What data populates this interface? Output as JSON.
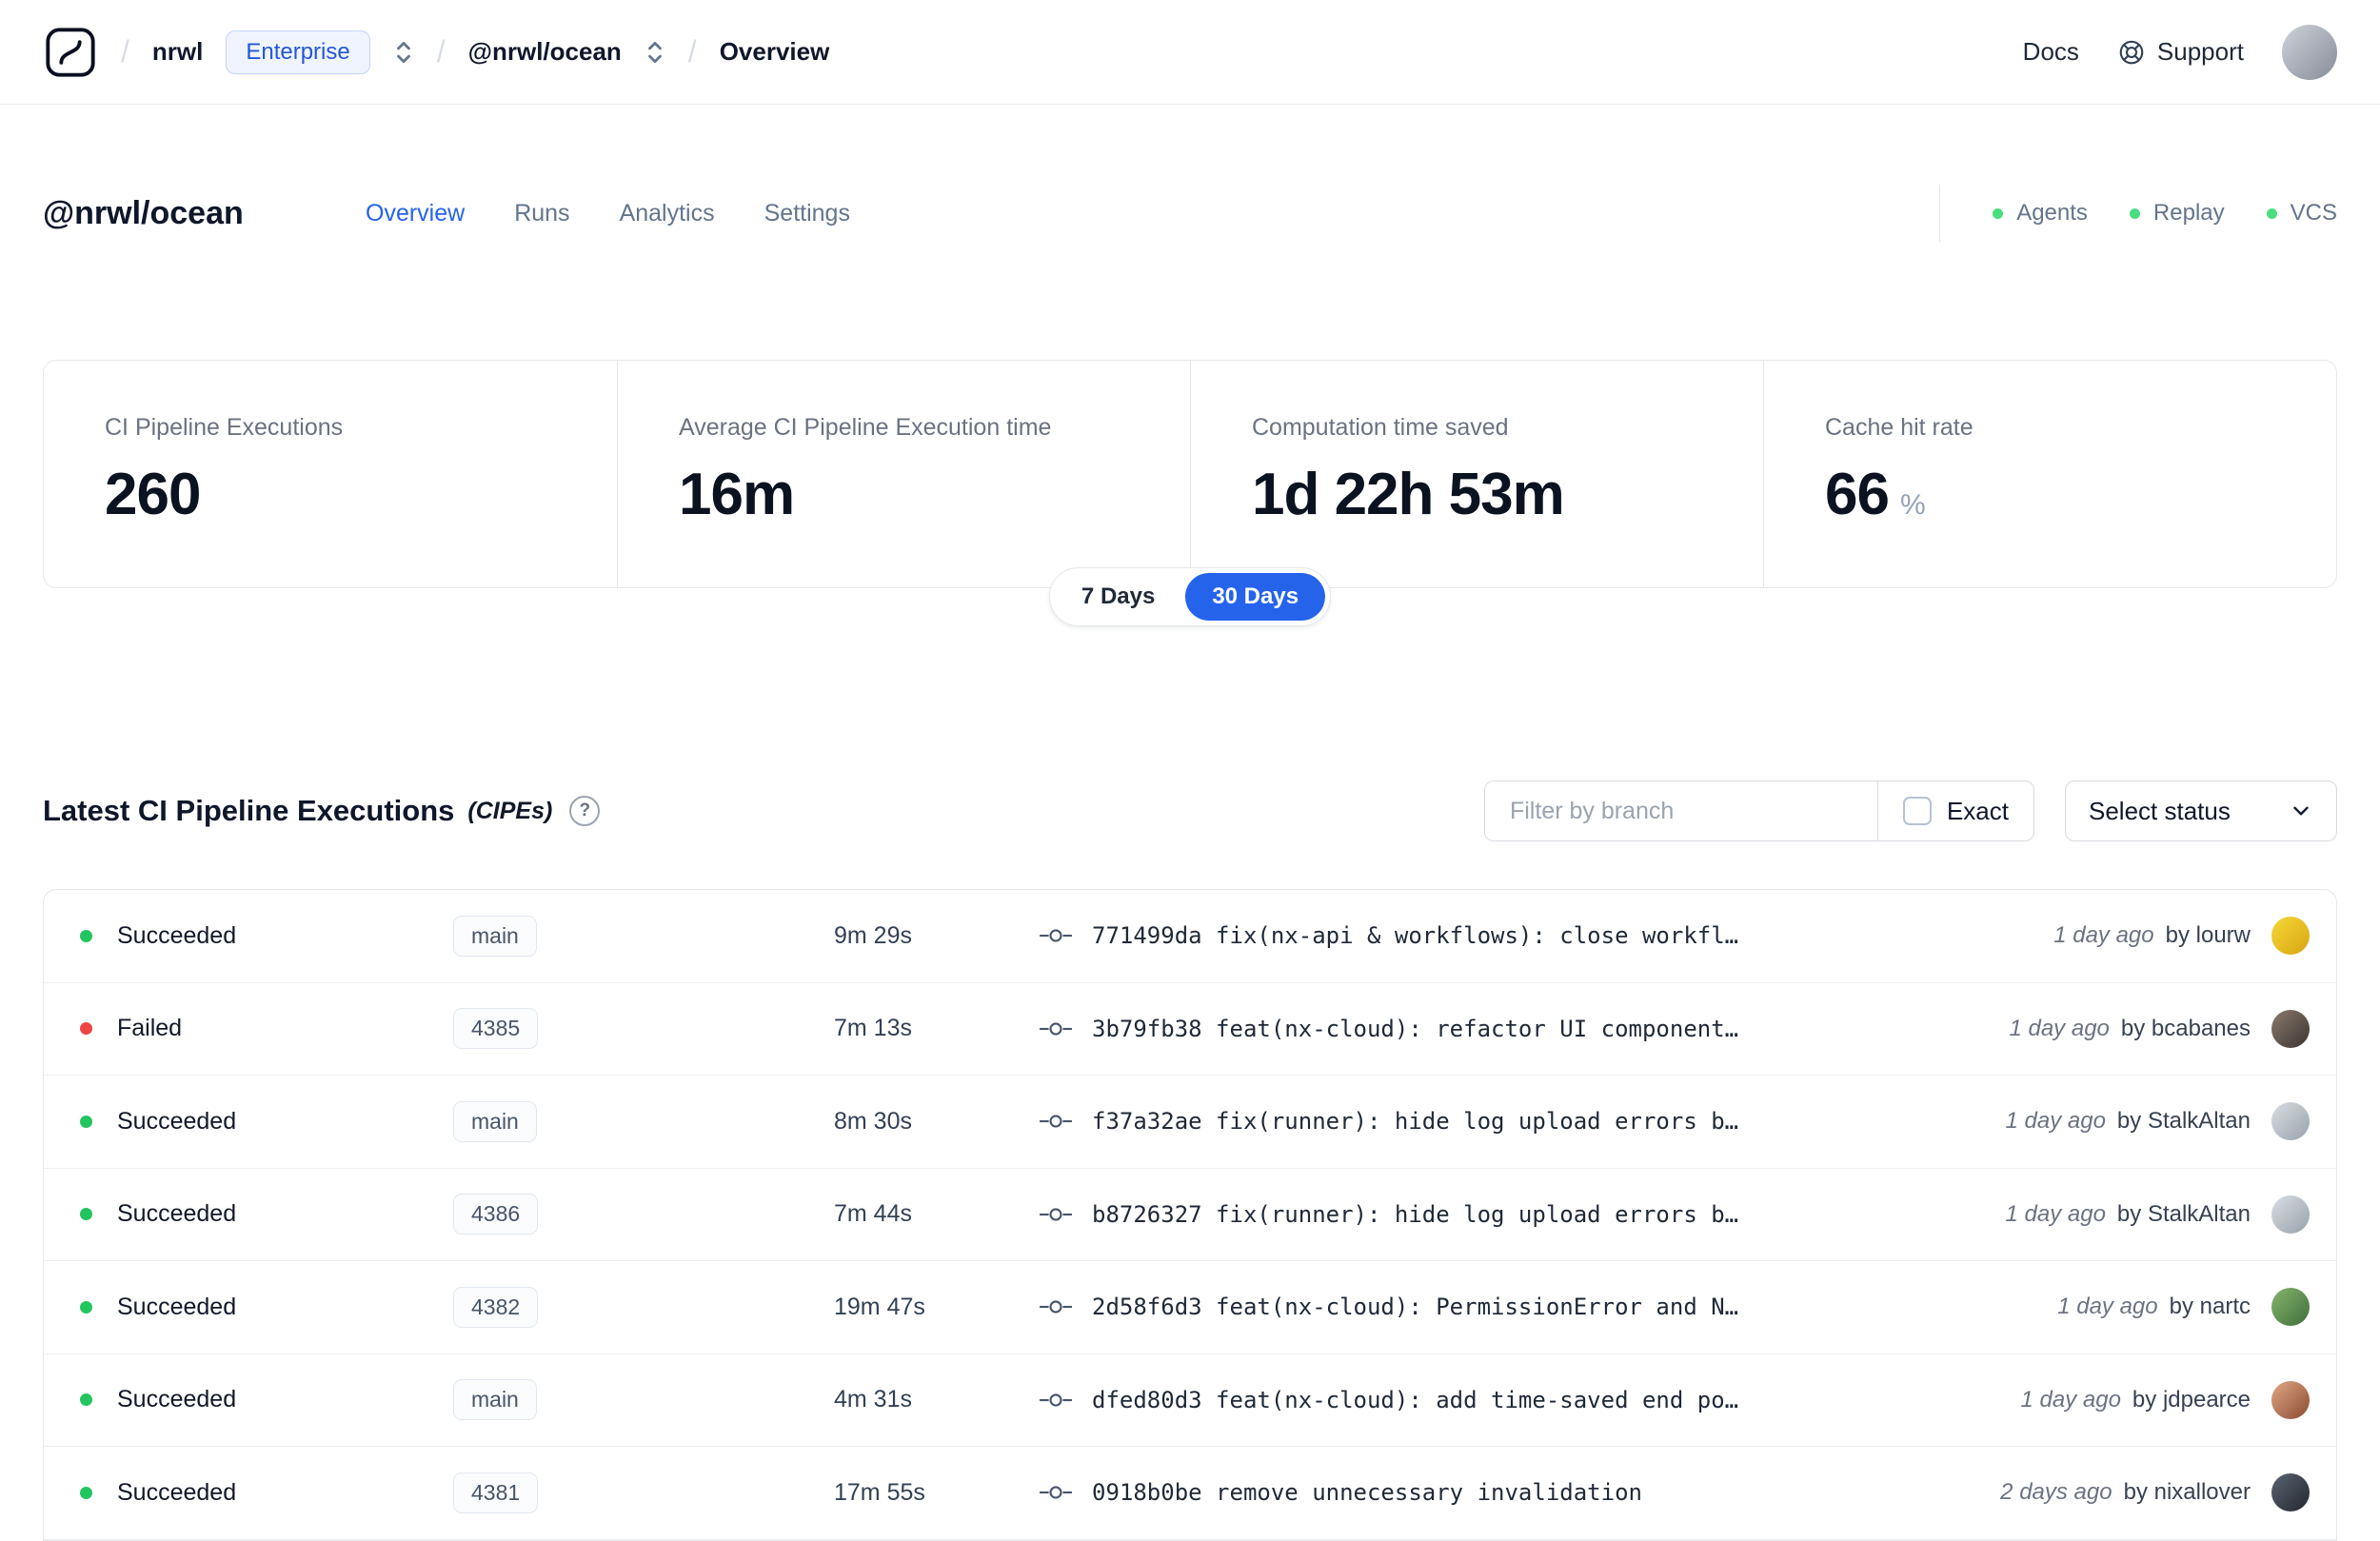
{
  "colors": {
    "accent_blue": "#2563eb",
    "success_green": "#22c55e",
    "failure_red": "#ef4444",
    "status_dot_green": "#4ade80"
  },
  "navbar": {
    "org": "nrwl",
    "org_badge": "Enterprise",
    "workspace": "@nrwl/ocean",
    "current_page": "Overview",
    "docs_label": "Docs",
    "support_label": "Support"
  },
  "header": {
    "title": "@nrwl/ocean",
    "tabs": [
      {
        "label": "Overview",
        "active": true
      },
      {
        "label": "Runs",
        "active": false
      },
      {
        "label": "Analytics",
        "active": false
      },
      {
        "label": "Settings",
        "active": false
      }
    ],
    "status_links": [
      {
        "label": "Agents"
      },
      {
        "label": "Replay"
      },
      {
        "label": "VCS"
      }
    ]
  },
  "stats": [
    {
      "label": "CI Pipeline Executions",
      "value": "260"
    },
    {
      "label": "Average CI Pipeline Execution time",
      "value": "16m"
    },
    {
      "label": "Computation time saved",
      "value": "1d 22h 53m"
    },
    {
      "label": "Cache hit rate",
      "value": "66",
      "suffix": "%"
    }
  ],
  "range_toggle": {
    "options": [
      {
        "label": "7 Days",
        "active": false
      },
      {
        "label": "30 Days",
        "active": true
      }
    ]
  },
  "cipe_section": {
    "title": "Latest CI Pipeline Executions",
    "subtitle": "(CIPEs)",
    "filter_placeholder": "Filter by branch",
    "exact_label": "Exact",
    "select_label": "Select status"
  },
  "rows": [
    {
      "status": "Succeeded",
      "dot_color": "#22c55e",
      "branch": "main",
      "duration": "9m 29s",
      "commit": "771499da fix(nx-api & workflows): close workfl…",
      "time": "1 day ago",
      "author": "by lourw",
      "avatar_colors": [
        "#f6d838",
        "#d8a512"
      ]
    },
    {
      "status": "Failed",
      "dot_color": "#ef4444",
      "branch": "4385",
      "duration": "7m 13s",
      "commit": "3b79fb38 feat(nx-cloud): refactor UI component…",
      "time": "1 day ago",
      "author": "by bcabanes",
      "avatar_colors": [
        "#8a7a6d",
        "#3c3430"
      ]
    },
    {
      "status": "Succeeded",
      "dot_color": "#22c55e",
      "branch": "main",
      "duration": "8m 30s",
      "commit": "f37a32ae fix(runner): hide log upload errors b…",
      "time": "1 day ago",
      "author": "by StalkAltan",
      "avatar_colors": [
        "#d9dee4",
        "#98a1ab"
      ]
    },
    {
      "status": "Succeeded",
      "dot_color": "#22c55e",
      "branch": "4386",
      "duration": "7m 44s",
      "commit": "b8726327 fix(runner): hide log upload errors b…",
      "time": "1 day ago",
      "author": "by StalkAltan",
      "avatar_colors": [
        "#d9dee4",
        "#98a1ab"
      ]
    },
    {
      "status": "Succeeded",
      "dot_color": "#22c55e",
      "branch": "4382",
      "duration": "19m 47s",
      "commit": "2d58f6d3 feat(nx-cloud): PermissionError and N…",
      "time": "1 day ago",
      "author": "by nartc",
      "avatar_colors": [
        "#86b46e",
        "#3f6f3a"
      ]
    },
    {
      "status": "Succeeded",
      "dot_color": "#22c55e",
      "branch": "main",
      "duration": "4m 31s",
      "commit": "dfed80d3 feat(nx-cloud): add time-saved end po…",
      "time": "1 day ago",
      "author": "by jdpearce",
      "avatar_colors": [
        "#e0a884",
        "#8a4a32"
      ]
    },
    {
      "status": "Succeeded",
      "dot_color": "#22c55e",
      "branch": "4381",
      "duration": "17m 55s",
      "commit": "0918b0be remove unnecessary invalidation",
      "time": "2 days ago",
      "author": "by nixallover",
      "avatar_colors": [
        "#5a6472",
        "#23272e"
      ]
    }
  ]
}
